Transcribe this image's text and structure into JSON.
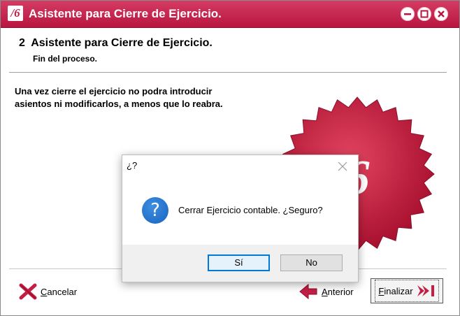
{
  "window": {
    "title": "Asistente para Cierre de Ejercicio.",
    "logo_text": "/6",
    "controls": [
      "minimize-icon",
      "maximize-icon",
      "close-icon"
    ],
    "accent": "#c41e45"
  },
  "header": {
    "title": "2  Asistente para Cierre de Ejercicio.",
    "subtitle": "Fin del proceso."
  },
  "body": {
    "message_line1": "Una vez cierre el ejercicio no podra introducir",
    "message_line2": "asientos ni modificarlos, a menos que lo reabra.",
    "seal_text": "/6"
  },
  "footer": {
    "cancel_label": "Cancelar",
    "previous_label": "Anterior",
    "finish_label": "Finalizar"
  },
  "dialog": {
    "title": "¿?",
    "icon": "question-icon",
    "message": "Cerrar Ejercicio contable. ¿Seguro?",
    "yes_label": "Sí",
    "no_label": "No",
    "default_color": "#0078d7"
  }
}
